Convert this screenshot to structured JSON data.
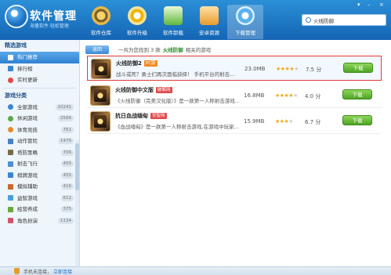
{
  "app": {
    "title": "软件管理",
    "subtitle": "海量软件 轻松管理",
    "window_controls": [
      "▾",
      "–",
      "×"
    ]
  },
  "nav": [
    {
      "label": "软件仓库",
      "icon": "store-icon"
    },
    {
      "label": "软件升级",
      "icon": "upgrade-icon"
    },
    {
      "label": "软件卸载",
      "icon": "uninstall-icon"
    },
    {
      "label": "安卓资源",
      "icon": "android-icon"
    },
    {
      "label": "下载管理",
      "icon": "download-icon",
      "active": true
    }
  ],
  "search": {
    "value": "火线防御",
    "placeholder": ""
  },
  "sidebar": {
    "featured_title": "精选游戏",
    "featured": [
      {
        "label": "热门推荐",
        "active": true
      },
      {
        "label": "排行榜"
      },
      {
        "label": "实时更新"
      }
    ],
    "category_title": "游戏分类",
    "categories": [
      {
        "label": "全部游戏",
        "count": "10241"
      },
      {
        "label": "休闲游戏",
        "count": "2566"
      },
      {
        "label": "体育竞技",
        "count": "761"
      },
      {
        "label": "动作冒险",
        "count": "1479"
      },
      {
        "label": "塔防策略",
        "count": "706"
      },
      {
        "label": "射击飞行",
        "count": "455"
      },
      {
        "label": "棋牌游戏",
        "count": "455"
      },
      {
        "label": "模拟辅助",
        "count": "416"
      },
      {
        "label": "益智游戏",
        "count": "612"
      },
      {
        "label": "经营养成",
        "count": "375"
      },
      {
        "label": "角色扮演",
        "count": "1134"
      }
    ]
  },
  "main": {
    "back_label": "返回",
    "result_prefix": "一共为您找到 3 款",
    "result_keyword": "火线防御",
    "result_suffix": "相关的游戏",
    "download_label": "下载",
    "rows": [
      {
        "name": "火线防御2",
        "tag": "PC版",
        "desc": "战斗或死？勇士们再次面临抉择！ 手机平台的射击...",
        "size": "23.0MB",
        "rating": 4.5,
        "score": "7.5 分",
        "stars": "★★★★",
        "half": "★"
      },
      {
        "name": "火线防御中文版",
        "tag": "破解网",
        "desc": "《火线防御（完美汉化版）》是一款第一人称射击游戏...",
        "size": "16.8MB",
        "rating": 4.0,
        "score": "4.0 分",
        "stars": "★★★★",
        "half": "★"
      },
      {
        "name": "抗日血战缅甸",
        "tag": "安智网",
        "desc": "《血战缅甸》是一款第一人称射击游戏,在游戏中玩家...",
        "size": "15.9MB",
        "rating": 3.5,
        "score": "6.7 分",
        "stars": "★★★",
        "half": "★"
      }
    ]
  },
  "status": {
    "text": "手机未连接，",
    "link": "立即连接"
  }
}
